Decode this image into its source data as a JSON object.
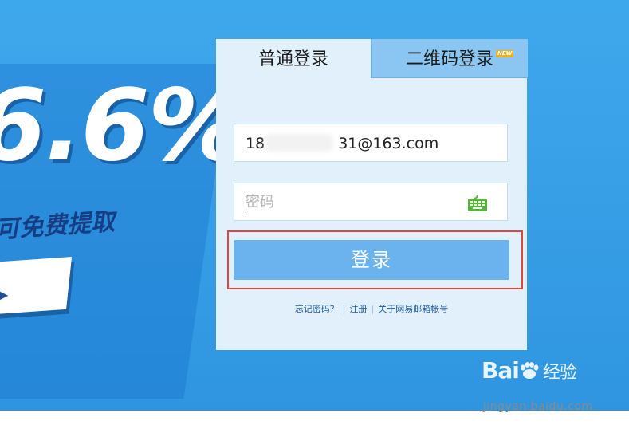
{
  "promo": {
    "percent": "6.6%",
    "subtitle": "可免费提取"
  },
  "tabs": [
    {
      "label": "普通登录",
      "active": true
    },
    {
      "label": "二维码登录",
      "badge": "NEW",
      "active": false
    }
  ],
  "form": {
    "account_value_prefix": "18",
    "account_value_suffix": "31@163.com",
    "password_placeholder": "密码",
    "keyboard_icon": "keyboard-icon",
    "submit_label": "登录"
  },
  "links": [
    {
      "label": "忘记密码？"
    },
    {
      "label": "注册"
    },
    {
      "label": "关于网易邮箱帐号"
    }
  ],
  "watermark": {
    "brand": "Bai",
    "brand_suffix": "经验",
    "url": "jingyan.baidu.com"
  },
  "colors": {
    "banner": "#3fa8ec",
    "panel": "#e2f0fb",
    "tab_inactive": "#8ac6f1",
    "button": "#6ab3ef",
    "highlight": "#e0463e",
    "link": "#1d5a9a",
    "keyboard_icon": "#56b43c"
  }
}
